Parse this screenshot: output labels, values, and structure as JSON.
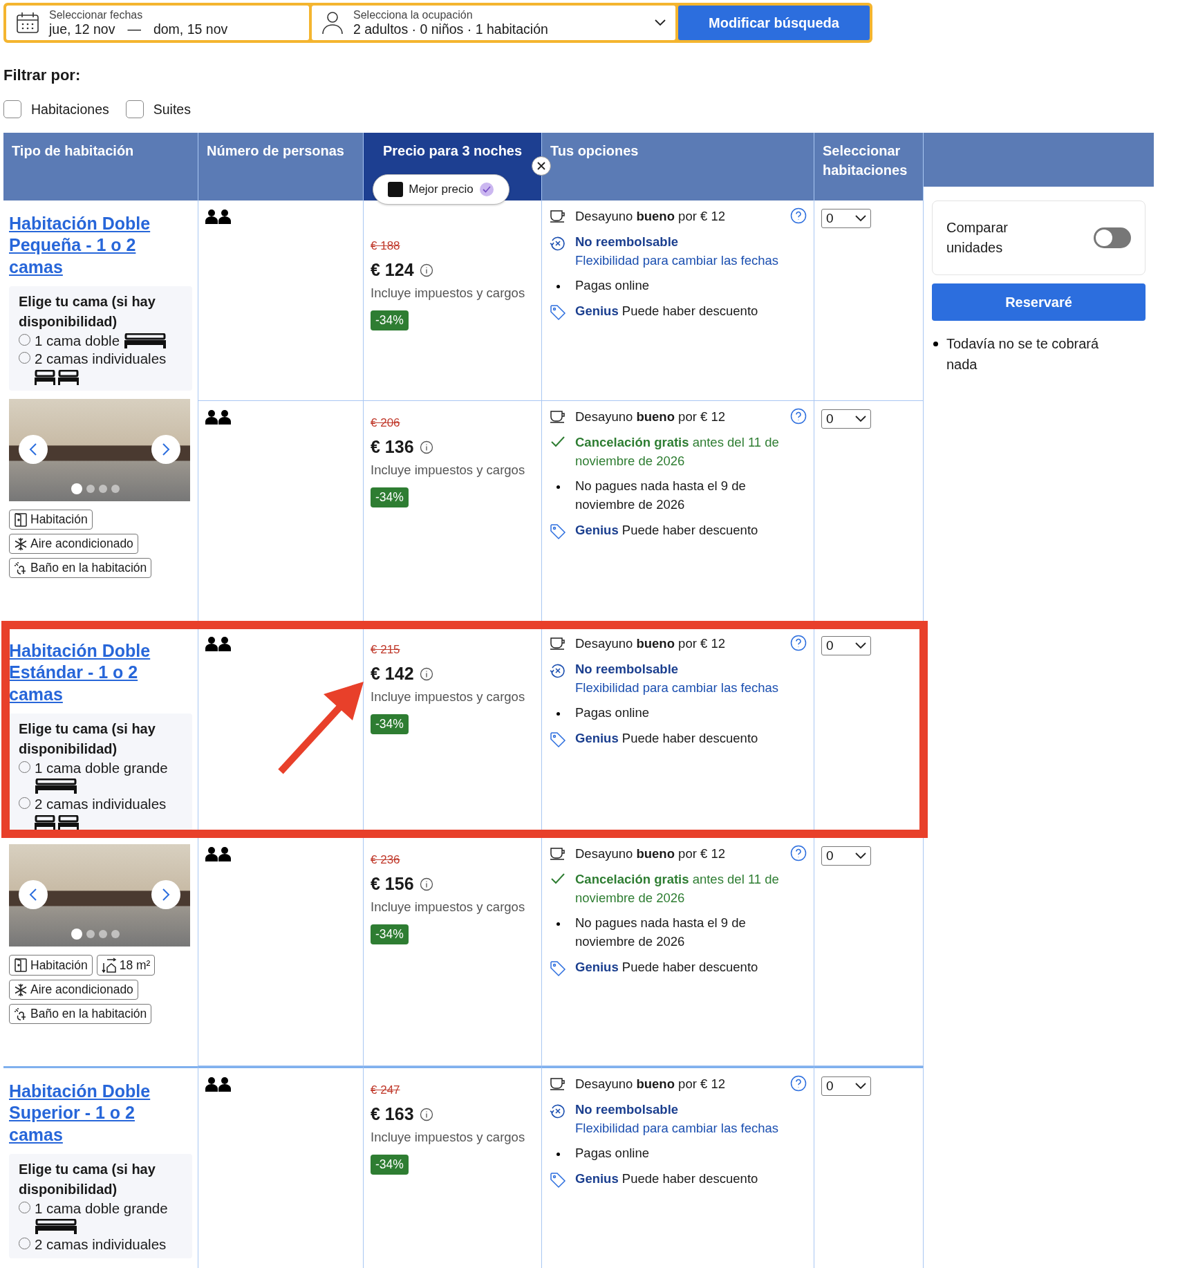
{
  "search_bar": {
    "dates": {
      "label": "Seleccionar fechas",
      "check_in": "jue, 12 nov",
      "separator": "—",
      "check_out": "dom, 15 nov"
    },
    "occupancy": {
      "label": "Selecciona la ocupación",
      "value": "2 adultos · 0 niños · 1 habitación"
    },
    "button": "Modificar búsqueda"
  },
  "filters": {
    "title": "Filtrar por:",
    "options": [
      {
        "label": "Habitaciones",
        "checked": false
      },
      {
        "label": "Suites",
        "checked": false
      }
    ]
  },
  "table": {
    "columns": [
      {
        "label": "Tipo de habitación",
        "selected": false
      },
      {
        "label": "Número de personas",
        "selected": false
      },
      {
        "label": "Precio para 3 noches",
        "selected": true
      },
      {
        "label": "Tus opciones",
        "selected": false
      },
      {
        "label": "Seleccionar habitaciones",
        "selected": false
      }
    ],
    "best_price_badge": "Mejor precio",
    "rooms": [
      {
        "name": "Habitación Doble Pequeña - 1 o 2 camas",
        "bed_choice": {
          "title": "Elige tu cama (si hay disponibilidad)",
          "options": [
            {
              "label": "1 cama doble",
              "kind": "double",
              "selected": false
            },
            {
              "label": "2 camas individuales",
              "kind": "twin",
              "selected": false
            }
          ]
        },
        "photo": true,
        "facilities": [
          {
            "kind": "room",
            "label": "Habitación"
          },
          {
            "kind": "ac",
            "label": "Aire acondicionado"
          },
          {
            "kind": "bath",
            "label": "Baño en la habitación"
          }
        ],
        "options": [
          {
            "original_price": "€ 188",
            "price": "€ 124",
            "price_note": "Incluye impuestos y cargos",
            "discount": "-34%",
            "breakfast": "Desayuno **bueno** por € 12",
            "policy": {
              "kind": "non_refundable",
              "title": "No reembolsable",
              "detail": "Flexibilidad para cambiar las fechas"
            },
            "payment": "Pagas online",
            "genius": "**Genius** Puede haber descuento",
            "quantity": "0"
          },
          {
            "original_price": "€ 206",
            "price": "€ 136",
            "price_note": "Incluye impuestos y cargos",
            "discount": "-34%",
            "breakfast": "Desayuno **bueno** por € 12",
            "policy": {
              "kind": "free_cancellation",
              "title": "**Cancelación gratis** antes del 11 de noviembre de 2026"
            },
            "payment": "No pagues nada hasta el 9 de noviembre de 2026",
            "genius": "**Genius** Puede haber descuento",
            "quantity": "0"
          }
        ]
      },
      {
        "name": "Habitación Doble Estándar - 1 o 2 camas",
        "bed_choice": {
          "title": "Elige tu cama (si hay disponibilidad)",
          "options": [
            {
              "label": "1 cama doble grande",
              "kind": "double",
              "selected": false
            },
            {
              "label": "2 camas individuales",
              "kind": "twin",
              "selected": false
            }
          ]
        },
        "photo": true,
        "facilities": [
          {
            "kind": "room",
            "label": "Habitación"
          },
          {
            "kind": "size",
            "label": "18 m²"
          },
          {
            "kind": "ac",
            "label": "Aire acondicionado"
          },
          {
            "kind": "bath",
            "label": "Baño en la habitación"
          }
        ],
        "options": [
          {
            "original_price": "€ 215",
            "price": "€ 142",
            "price_note": "Incluye impuestos y cargos",
            "discount": "-34%",
            "breakfast": "Desayuno **bueno** por € 12",
            "policy": {
              "kind": "non_refundable",
              "title": "No reembolsable",
              "detail": "Flexibilidad para cambiar las fechas"
            },
            "payment": "Pagas online",
            "genius": "**Genius** Puede haber descuento",
            "quantity": "0"
          },
          {
            "original_price": "€ 236",
            "price": "€ 156",
            "price_note": "Incluye impuestos y cargos",
            "discount": "-34%",
            "breakfast": "Desayuno **bueno** por € 12",
            "policy": {
              "kind": "free_cancellation",
              "title": "**Cancelación gratis** antes del 11 de noviembre de 2026"
            },
            "payment": "No pagues nada hasta el 9 de noviembre de 2026",
            "genius": "**Genius** Puede haber descuento",
            "quantity": "0"
          }
        ]
      },
      {
        "name": "Habitación Doble Superior - 1 o 2 camas",
        "bed_choice": {
          "title": "Elige tu cama (si hay disponibilidad)",
          "options": [
            {
              "label": "1 cama doble grande",
              "kind": "double",
              "selected": false
            },
            {
              "label": "2 camas individuales",
              "selected": false
            }
          ]
        },
        "photo": false,
        "options": [
          {
            "original_price": "€ 247",
            "price": "€ 163",
            "price_note": "Incluye impuestos y cargos",
            "discount": "-34%",
            "breakfast": "Desayuno **bueno** por € 12",
            "policy": {
              "kind": "non_refundable",
              "title": "No reembolsable",
              "detail": "Flexibilidad para cambiar las fechas"
            },
            "payment": "Pagas online",
            "genius": "**Genius** Puede haber descuento",
            "quantity": "0"
          }
        ]
      }
    ]
  },
  "sidebar": {
    "compare": {
      "label": "Comparar unidades",
      "on": false
    },
    "button": "Reservaré",
    "notes": [
      "Todavía no se te cobrará nada"
    ]
  }
}
